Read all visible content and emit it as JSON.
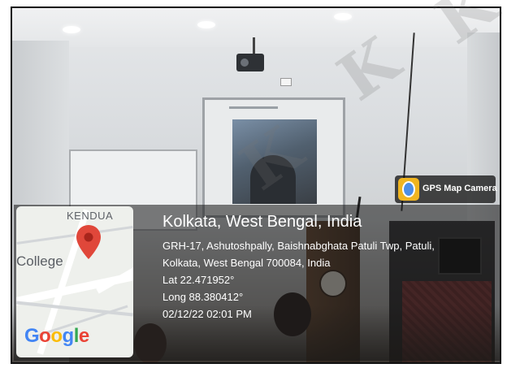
{
  "map": {
    "place_top": "KENDUA",
    "place_left": "College",
    "logo": "Google",
    "pin_icon": "map-pin-icon",
    "logo_colors": [
      "#4285F4",
      "#EA4335",
      "#FBBC05",
      "#4285F4",
      "#34A853",
      "#EA4335"
    ]
  },
  "badge": {
    "label": "GPS Map Camera",
    "icon": "gps-map-camera-icon"
  },
  "location": {
    "title": "Kolkata, West Bengal, India",
    "address_line1": "GRH-17, Ashutoshpally, Baishnabghata Patuli Twp, Patuli,",
    "address_line2": "Kolkata, West Bengal 700084, India",
    "lat": "Lat 22.471952°",
    "long": "Long 88.380412°",
    "datetime": "02/12/22 02:01 PM"
  },
  "watermark": "K"
}
